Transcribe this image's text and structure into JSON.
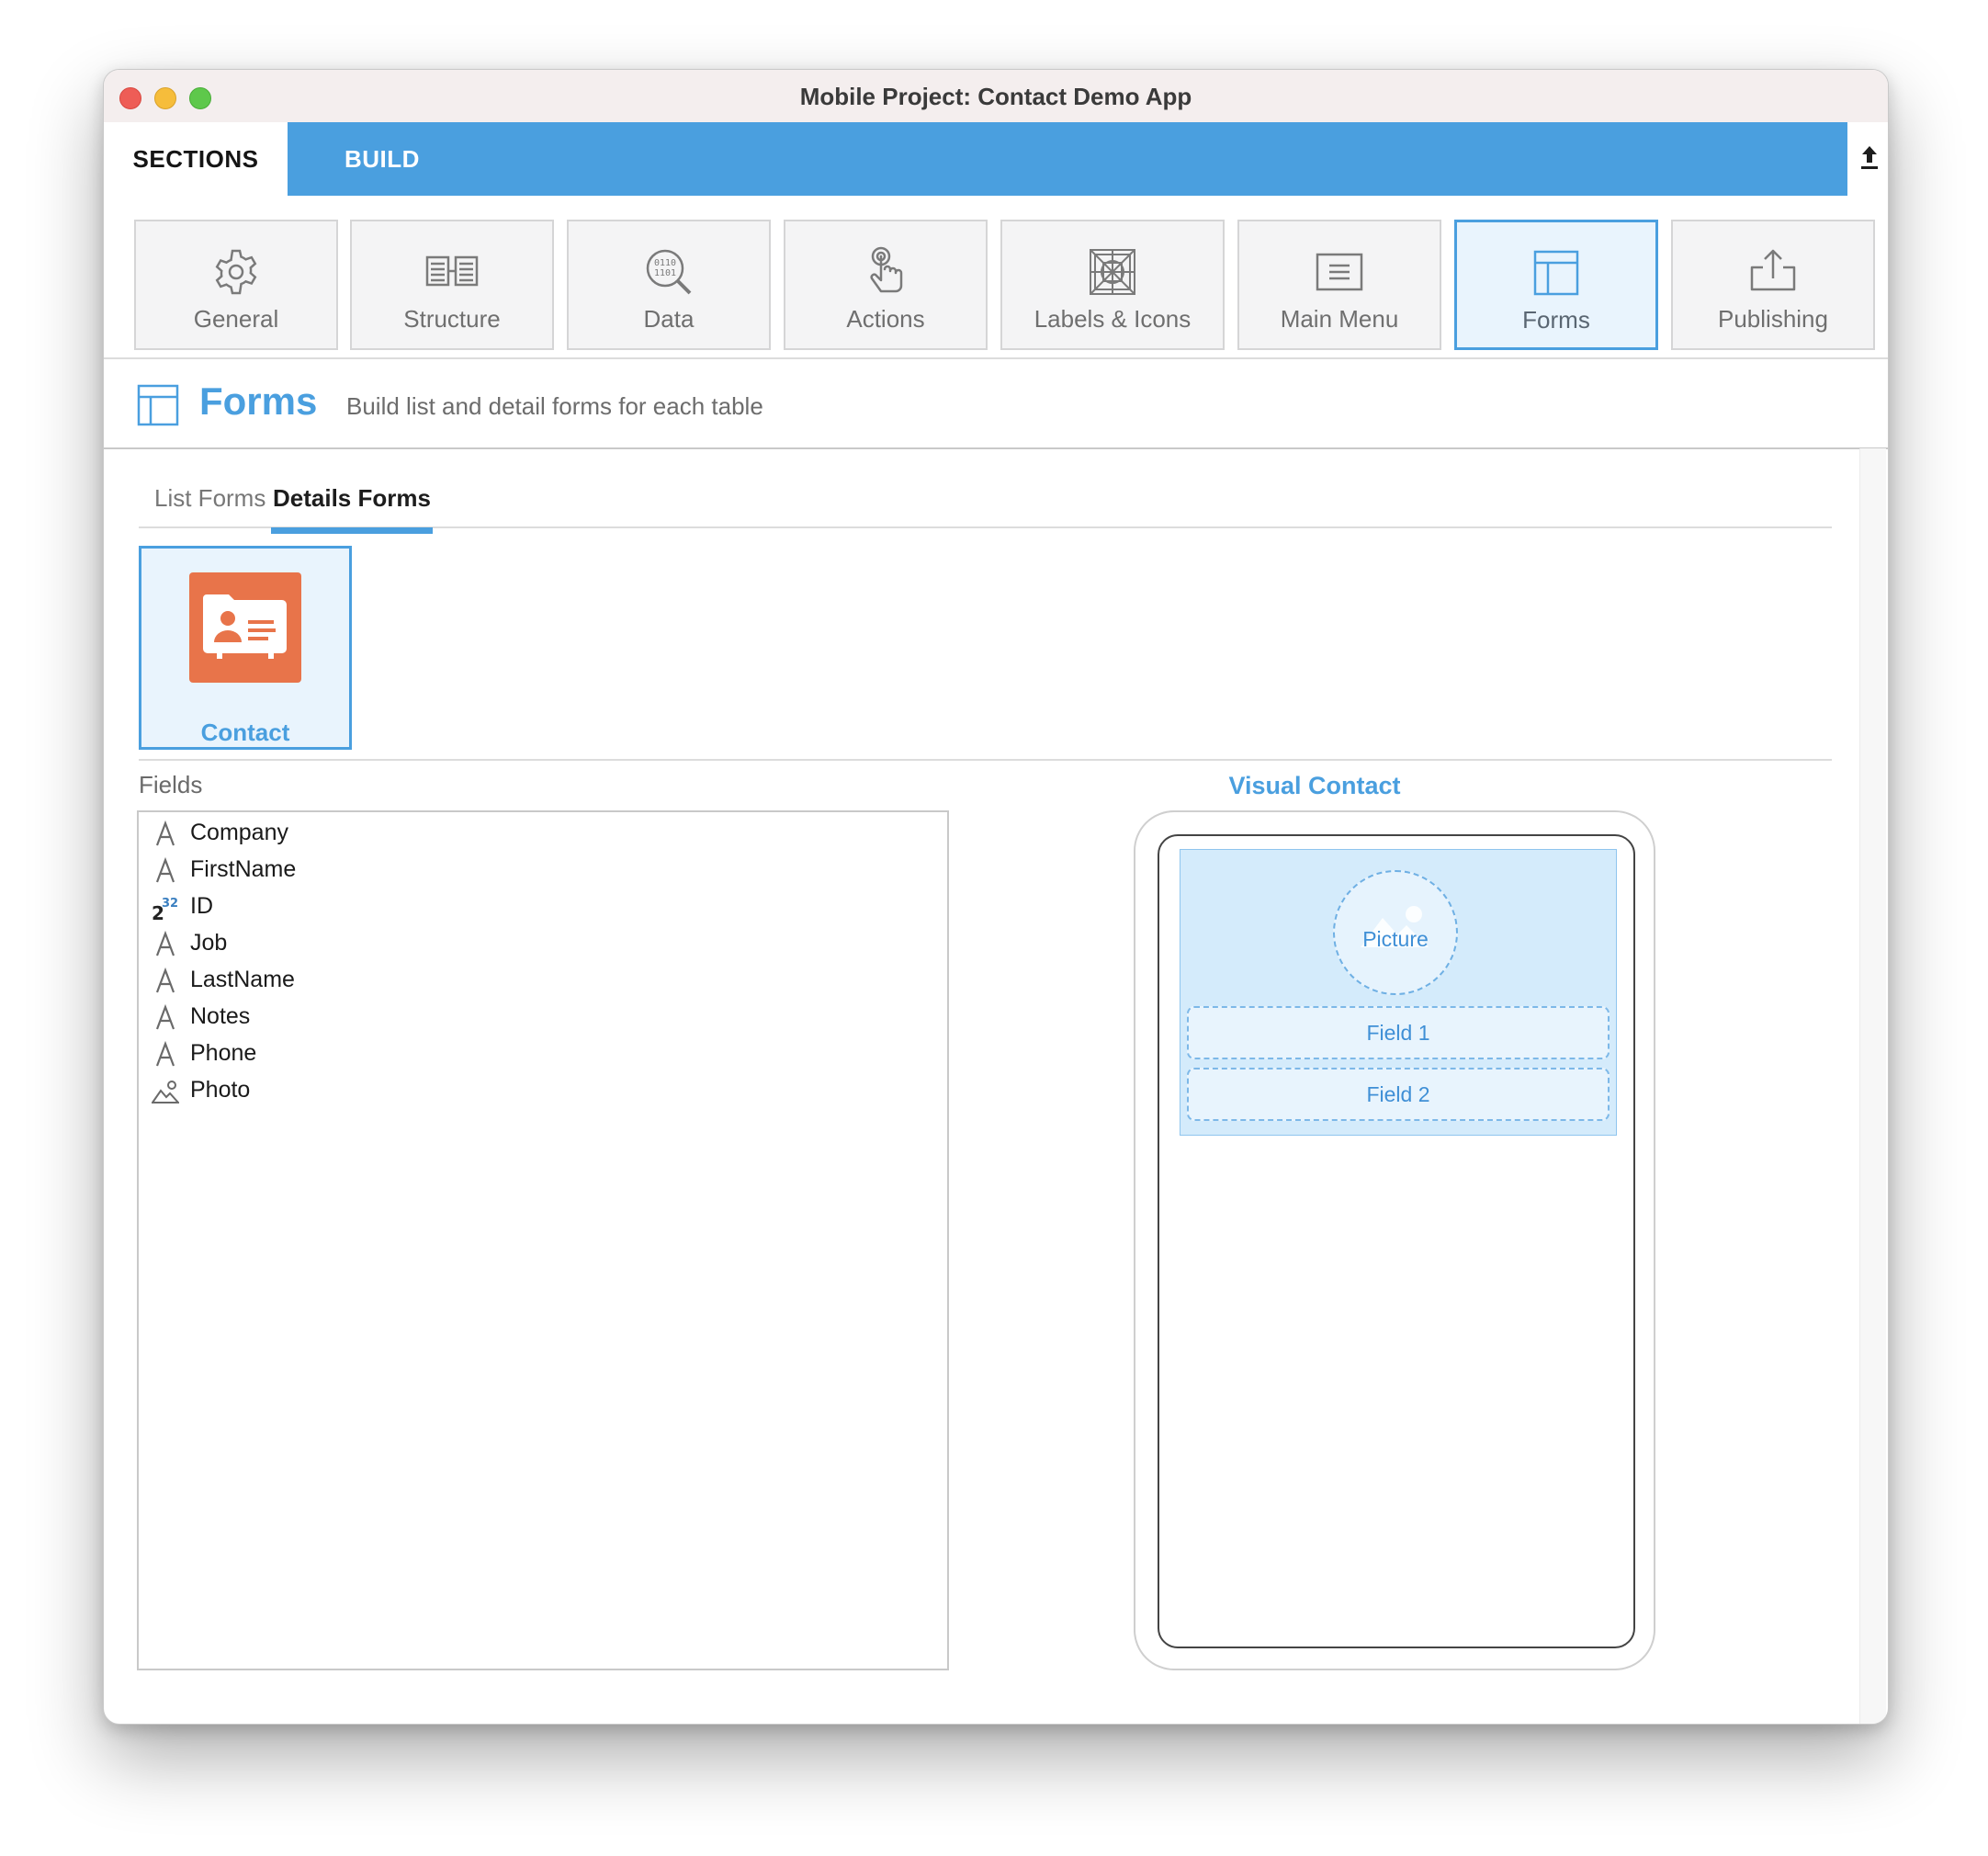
{
  "window": {
    "title": "Mobile Project: Contact Demo App"
  },
  "tabs": {
    "sections_label": "SECTIONS",
    "build_label": "BUILD"
  },
  "sections": [
    {
      "label": "General",
      "icon": "gear-icon"
    },
    {
      "label": "Structure",
      "icon": "structure-icon"
    },
    {
      "label": "Data",
      "icon": "data-search-icon"
    },
    {
      "label": "Actions",
      "icon": "touch-hand-icon"
    },
    {
      "label": "Labels & Icons",
      "icon": "labels-icons-grid-icon"
    },
    {
      "label": "Main Menu",
      "icon": "menu-list-icon"
    },
    {
      "label": "Forms",
      "icon": "forms-layout-icon",
      "active": true
    },
    {
      "label": "Publishing",
      "icon": "upload-tray-icon"
    }
  ],
  "header": {
    "title": "Forms",
    "description": "Build list and detail forms for each table"
  },
  "subtabs": {
    "list_forms": "List Forms",
    "details_forms": "Details Forms",
    "active": "Details Forms"
  },
  "tables": [
    {
      "label": "Contact",
      "icon": "contact-card-icon",
      "selected": true
    }
  ],
  "fields": {
    "label": "Fields",
    "items": [
      {
        "name": "Company",
        "icon": "text-type-icon"
      },
      {
        "name": "FirstName",
        "icon": "text-type-icon"
      },
      {
        "name": "ID",
        "icon": "integer-type-icon"
      },
      {
        "name": "Job",
        "icon": "text-type-icon"
      },
      {
        "name": "LastName",
        "icon": "text-type-icon"
      },
      {
        "name": "Notes",
        "icon": "text-type-icon"
      },
      {
        "name": "Phone",
        "icon": "text-type-icon"
      },
      {
        "name": "Photo",
        "icon": "picture-type-icon"
      }
    ]
  },
  "visual": {
    "title": "Visual Contact",
    "picture_label": "Picture",
    "field1_label": "Field 1",
    "field2_label": "Field 2"
  },
  "colors": {
    "accent": "#4a9fdf",
    "contact_icon": "#e8744a",
    "drop_zone": "#d4ebfb"
  }
}
